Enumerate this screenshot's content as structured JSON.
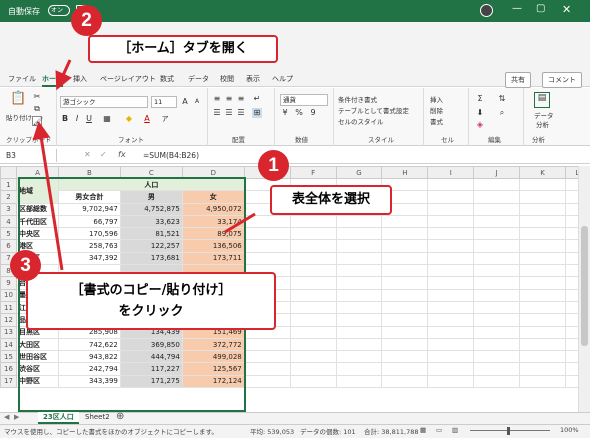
{
  "colors": {
    "accent": "#217346",
    "callout": "#d9262e",
    "header_green": "#e2efda",
    "male": "#d9d9d9",
    "female": "#f8cbad"
  },
  "titlebar": {
    "autosave_label": "自動保存",
    "autosave_state": "オン"
  },
  "tabs": [
    "ファイル",
    "ホーム",
    "挿入",
    "ページレイアウト",
    "数式",
    "データ",
    "校閲",
    "表示",
    "ヘルプ"
  ],
  "active_tab": "ホーム",
  "ribbon_right": {
    "share": "共有",
    "comment": "コメント"
  },
  "ribbon": {
    "clipboard": {
      "paste": "貼り付け",
      "label": "クリップボード"
    },
    "font": {
      "name": "游ゴシック",
      "size": "11",
      "label": "フォント"
    },
    "alignment": {
      "label": "配置"
    },
    "number": {
      "format": "通貨",
      "label": "数値"
    },
    "styles": {
      "conditional": "条件付き書式",
      "table": "テーブルとして書式設定",
      "cell_style": "セルのスタイル",
      "label": "スタイル"
    },
    "cells": {
      "insert": "挿入",
      "delete": "削除",
      "format": "書式",
      "label": "セル"
    },
    "editing": {
      "label": "編集"
    },
    "analysis": {
      "data": "データ",
      "analyze": "分析",
      "label": "分析"
    }
  },
  "formula_bar": {
    "cell_ref": "B3",
    "formula": "=SUM(B4:B26)",
    "fx": "fx"
  },
  "columns": [
    "A",
    "B",
    "C",
    "D",
    "E",
    "F",
    "G",
    "H",
    "I",
    "J",
    "K",
    "L"
  ],
  "header_row1": {
    "a": "地域",
    "merged": "人口"
  },
  "header_row2": {
    "b": "男女合計",
    "c": "男",
    "d": "女"
  },
  "rows": [
    {
      "n": "3",
      "a": "区部総数",
      "b": "9,702,947",
      "c": "4,752,875",
      "d": "4,950,072"
    },
    {
      "n": "4",
      "a": "千代田区",
      "b": "66,797",
      "c": "33,623",
      "d": "33,174"
    },
    {
      "n": "5",
      "a": "中央区",
      "b": "170,596",
      "c": "81,521",
      "d": "89,075"
    },
    {
      "n": "6",
      "a": "港区",
      "b": "258,763",
      "c": "122,257",
      "d": "136,506"
    },
    {
      "n": "7",
      "a": "新宿区",
      "b": "347,392",
      "c": "173,681",
      "d": "173,711"
    },
    {
      "n": "8",
      "a": "文京区",
      "b": "",
      "c": "",
      "d": ""
    },
    {
      "n": "9",
      "a": "台東区",
      "b": "",
      "c": "",
      "d": ""
    },
    {
      "n": "10",
      "a": "墨田区",
      "b": "",
      "c": "",
      "d": ""
    },
    {
      "n": "11",
      "a": "江東区",
      "b": "",
      "c": "",
      "d": ""
    },
    {
      "n": "12",
      "a": "品川区",
      "b": "420,064",
      "c": "207,137",
      "d": "212,927"
    },
    {
      "n": "13",
      "a": "目黒区",
      "b": "285,908",
      "c": "134,439",
      "d": "151,469"
    },
    {
      "n": "14",
      "a": "大田区",
      "b": "742,622",
      "c": "369,850",
      "d": "372,772"
    },
    {
      "n": "15",
      "a": "世田谷区",
      "b": "943,822",
      "c": "444,794",
      "d": "499,028"
    },
    {
      "n": "16",
      "a": "渋谷区",
      "b": "242,794",
      "c": "117,227",
      "d": "125,567"
    },
    {
      "n": "17",
      "a": "中野区",
      "b": "343,399",
      "c": "171,275",
      "d": "172,124"
    }
  ],
  "sheets": [
    "23区人口",
    "Sheet2"
  ],
  "status": {
    "message": "マウスを使用し、コピーした書式をほかのオブジェクトにコピーします。",
    "average": "平均: 539,053",
    "count": "データの個数: 101",
    "sum": "合計: 38,811,788",
    "zoom": "100%"
  },
  "callouts": {
    "step1_num": "1",
    "step1_text": "表全体を選択",
    "step2_num": "2",
    "step2_text": "［ホーム］タブを開く",
    "step3_num": "3",
    "step3_line1": "［書式のコピー/貼り付け］",
    "step3_line2": "をクリック"
  }
}
